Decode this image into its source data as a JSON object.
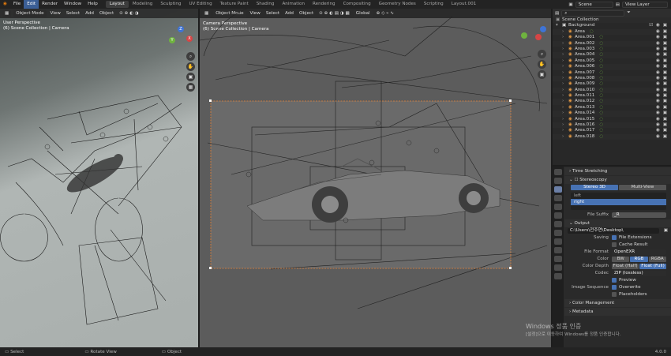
{
  "menu": {
    "items": [
      "File",
      "Edit",
      "Render",
      "Window",
      "Help"
    ],
    "active": "Edit"
  },
  "workspaces": {
    "tabs": [
      "Layout",
      "Modeling",
      "Sculpting",
      "UV Editing",
      "Texture Paint",
      "Shading",
      "Animation",
      "Rendering",
      "Compositing",
      "Geometry Nodes",
      "Scripting",
      "Layout.001"
    ],
    "active": "Layout"
  },
  "topbar": {
    "scene": "Scene",
    "view_layer": "View Layer"
  },
  "left_viewport": {
    "mode": "Object Mode",
    "view": "View",
    "select": "Select",
    "add": "Add",
    "object": "Object",
    "title": "User Perspective",
    "subtitle": "(6) Scene Collection | Camera"
  },
  "mid_viewport": {
    "mode": "Object Mode",
    "view": "View",
    "select": "Select",
    "add": "Add",
    "object": "Object",
    "orientation": "Global",
    "title": "Camera Perspective",
    "subtitle": "(6) Scene Collection | Camera"
  },
  "outliner": {
    "scene_collection": "Scene Collection",
    "background": "Background",
    "items": [
      "Area",
      "Area.001",
      "Area.002",
      "Area.003",
      "Area.004",
      "Area.005",
      "Area.006",
      "Area.007",
      "Area.008",
      "Area.009",
      "Area.010",
      "Area.011",
      "Area.012",
      "Area.013",
      "Area.014",
      "Area.015",
      "Area.016",
      "Area.017",
      "Area.018"
    ]
  },
  "properties": {
    "time_stretching": "Time Stretching",
    "stereoscopy": "Stereoscopy",
    "stereo_modes": [
      "Stereo 3D",
      "Multi-View"
    ],
    "views": [
      "left",
      "right"
    ],
    "file_suffix_label": "File Suffix",
    "file_suffix_value": "_R",
    "output": "Output",
    "path": "C:\\Users\\전주연\\Desktop\\",
    "saving_label": "Saving",
    "file_extensions": "File Extensions",
    "cache_result": "Cache Result",
    "file_format_label": "File Format",
    "file_format": "OpenEXR",
    "color_label": "Color",
    "color_modes": [
      "BW",
      "RGB",
      "RGBA"
    ],
    "color_active": "RGB",
    "depth_label": "Color Depth",
    "depths": [
      "Float (Half)",
      "Float (Full)"
    ],
    "depth_active": "Float (Full)",
    "codec_label": "Codec",
    "codec": "ZIP (lossless)",
    "preview": "Preview",
    "sequence_label": "Image Sequence",
    "overwrite": "Overwrite",
    "placeholders": "Placeholders",
    "color_management": "Color Management",
    "metadata": "Metadata"
  },
  "status": {
    "select": "Select",
    "rotate": "Rotate View",
    "object": "Object",
    "version": "4.0.0"
  },
  "watermark": {
    "line1": "Windows 정품 인증",
    "line2": "[설정]으로 이동하여 Windows를 정품 인증합니다."
  },
  "colors": {
    "accent": "#4772b3",
    "header": "#232323",
    "orange": "#e59a45",
    "selected_camera": "#e8843a"
  }
}
